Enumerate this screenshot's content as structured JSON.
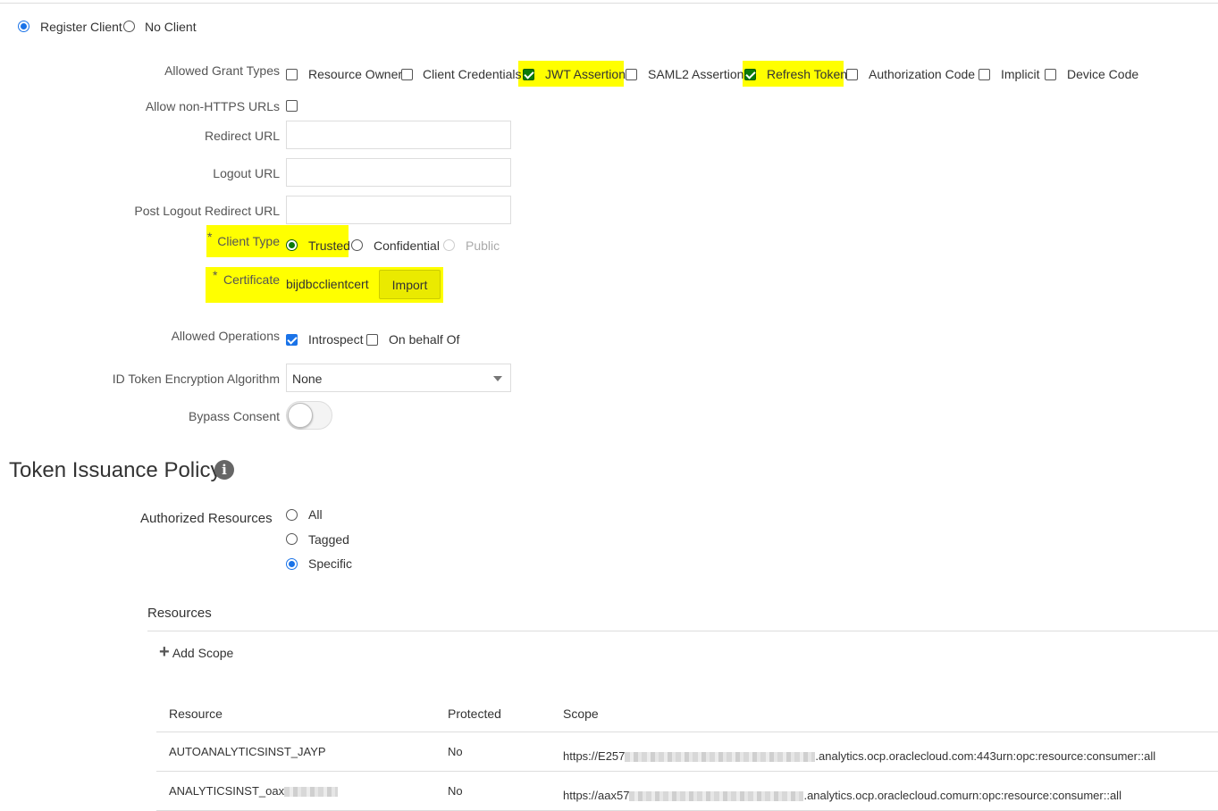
{
  "client_mode": {
    "register": "Register Client",
    "none": "No Client",
    "selected": "register"
  },
  "grant_types": {
    "label": "Allowed Grant Types",
    "items": [
      {
        "label": "Resource Owner",
        "checked": false
      },
      {
        "label": "Client Credentials",
        "checked": false
      },
      {
        "label": "JWT Assertion",
        "checked": true
      },
      {
        "label": "SAML2 Assertion",
        "checked": false
      },
      {
        "label": "Refresh Token",
        "checked": true
      },
      {
        "label": "Authorization Code",
        "checked": false
      },
      {
        "label": "Implicit",
        "checked": false
      },
      {
        "label": "Device Code",
        "checked": false
      }
    ]
  },
  "non_https": {
    "label": "Allow non-HTTPS URLs",
    "checked": false
  },
  "redirect_url": {
    "label": "Redirect URL",
    "value": ""
  },
  "logout_url": {
    "label": "Logout URL",
    "value": ""
  },
  "post_logout_url": {
    "label": "Post Logout Redirect URL",
    "value": ""
  },
  "client_type": {
    "required": "*",
    "label": "Client Type",
    "options": [
      "Trusted",
      "Confidential",
      "Public"
    ],
    "selected": "Trusted"
  },
  "certificate": {
    "required": "*",
    "label": "Certificate",
    "value": "bijdbcclientcert",
    "import_label": "Import"
  },
  "operations": {
    "label": "Allowed Operations",
    "items": [
      {
        "label": "Introspect",
        "checked": true
      },
      {
        "label": "On behalf Of",
        "checked": false
      }
    ]
  },
  "id_token_enc": {
    "label": "ID Token Encryption Algorithm",
    "value": "None"
  },
  "bypass_consent": {
    "label": "Bypass Consent",
    "on": false
  },
  "policy": {
    "title": "Token Issuance Policy",
    "auth_label": "Authorized Resources",
    "options": [
      "All",
      "Tagged",
      "Specific"
    ],
    "selected": "Specific"
  },
  "resources": {
    "title": "Resources",
    "add_scope": "Add Scope",
    "columns": [
      "Resource",
      "Protected",
      "Scope"
    ],
    "rows": [
      {
        "resource": "AUTOANALYTICSINST_JAYP",
        "protected": "No",
        "scope_prefix": "https://E257",
        "scope_suffix": ".analytics.ocp.oraclecloud.com:443urn:opc:resource:consumer::all"
      },
      {
        "resource": "ANALYTICSINST_oax",
        "protected": "No",
        "scope_prefix": "https://aax57",
        "scope_suffix": ".analytics.ocp.oraclecloud.comurn:opc:resource:consumer::all"
      }
    ]
  },
  "colors": {
    "highlight": "#ffff00",
    "accent": "#1a73e8"
  }
}
